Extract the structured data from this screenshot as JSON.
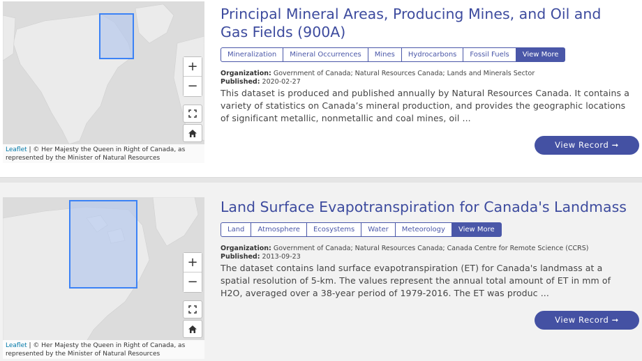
{
  "records": [
    {
      "title": "Principal Mineral Areas, Producing Mines, and Oil and Gas Fields (900A)",
      "tags": [
        "Mineralization",
        "Mineral Occurrences",
        "Mines",
        "Hydrocarbons",
        "Fossil Fuels"
      ],
      "more_label": "View More",
      "organization_label": "Organization:",
      "organization": "Government of Canada; Natural Resources Canada; Lands and Minerals Sector",
      "published_label": "Published:",
      "published": "2020-02-27",
      "description": "This dataset is produced and published annually by Natural Resources Canada. It contains a variety of statistics on Canada’s mineral production, and provides the geographic locations of significant metallic, nonmetallic and coal mines, oil ...",
      "button_label": "View Record ➞",
      "map": {
        "zoom_in": "+",
        "zoom_out": "−",
        "attribution_link": "Leaflet",
        "attribution_text": " | © Her Majesty the Queen in Right of Canada, as represented by the Minister of Natural Resources"
      }
    },
    {
      "title": "Land Surface Evapotranspiration for Canada's Landmass",
      "tags": [
        "Land",
        "Atmosphere",
        "Ecosystems",
        "Water",
        "Meteorology"
      ],
      "more_label": "View More",
      "organization_label": "Organization:",
      "organization": "Government of Canada; Natural Resources Canada; Canada Centre for Remote Science (CCRS)",
      "published_label": "Published:",
      "published": "2013-09-23",
      "description": "The dataset contains land surface evapotranspiration (ET) for Canada's landmass at a spatial resolution of 5-km. The values represent the annual total amount of ET in mm of H2O, averaged over a 38-year period of 1979-2016. The ET was produc ...",
      "button_label": "View Record ➞",
      "map": {
        "zoom_in": "+",
        "zoom_out": "−",
        "attribution_link": "Leaflet",
        "attribution_text": " | © Her Majesty the Queen in Right of Canada, as represented by the Minister of Natural Resources"
      }
    }
  ],
  "colors": {
    "accent": "#4451a3",
    "title": "#3d4b9e",
    "map_water": "#dcdcdc",
    "map_land": "#ebebeb",
    "extent_fill": "#b7c9ec",
    "extent_stroke": "#3b82f6"
  },
  "icons": {
    "fullscreen": "fullscreen-icon",
    "home": "home-icon",
    "arrow": "arrow-right-icon"
  }
}
